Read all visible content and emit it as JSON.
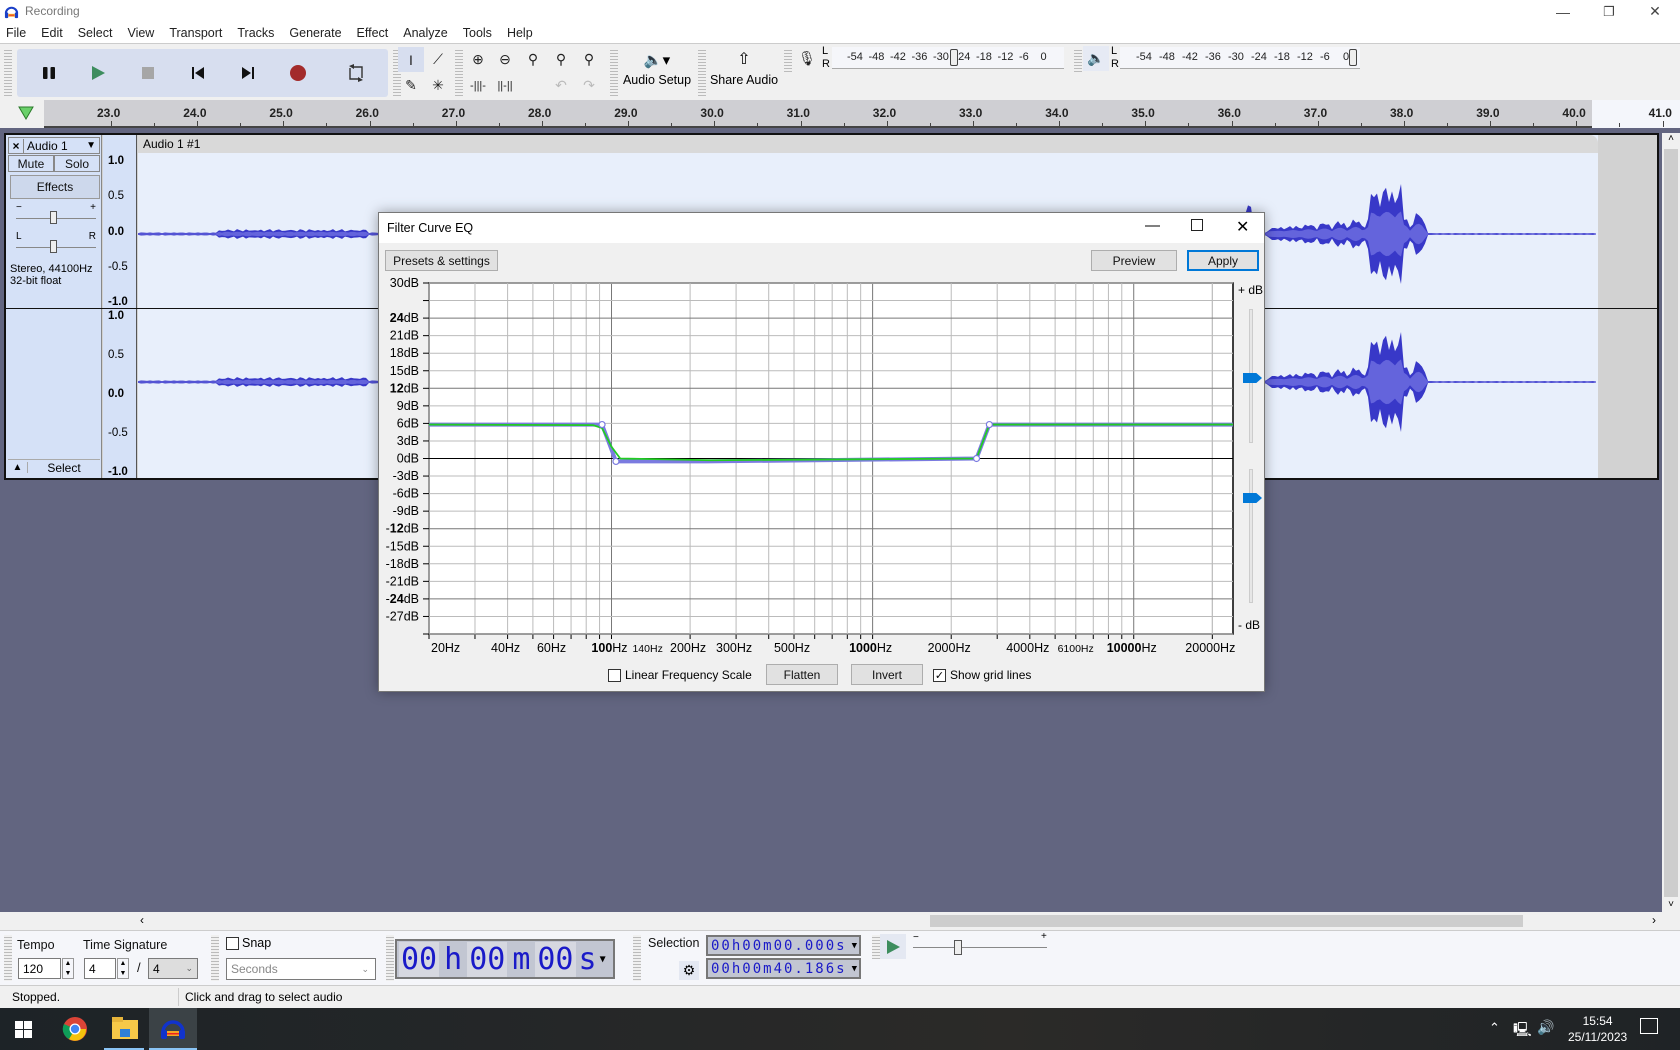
{
  "window": {
    "title": "Recording",
    "minimize": "—",
    "maximize": "❐",
    "close": "✕"
  },
  "menu": [
    "File",
    "Edit",
    "Select",
    "View",
    "Transport",
    "Tracks",
    "Generate",
    "Effect",
    "Analyze",
    "Tools",
    "Help"
  ],
  "transport": {
    "buttons": [
      "pause",
      "play",
      "stop",
      "skip-to-start",
      "skip-to-end",
      "record",
      "loop"
    ]
  },
  "tools": {
    "audio_setup": "Audio Setup",
    "share_audio": "Share Audio"
  },
  "meters": {
    "record_scale": [
      "-54",
      "-48",
      "-42",
      "-36",
      "-30",
      "-24",
      "-18",
      "-12",
      "-6",
      "0"
    ],
    "play_scale": [
      "-54",
      "-48",
      "-42",
      "-36",
      "-30",
      "-24",
      "-18",
      "-12",
      "-6",
      "0"
    ],
    "L": "L",
    "R": "R"
  },
  "ruler": {
    "ticks": [
      "23.0",
      "24.0",
      "25.0",
      "26.0",
      "27.0",
      "28.0",
      "29.0",
      "30.0",
      "31.0",
      "32.0",
      "33.0",
      "34.0",
      "35.0",
      "36.0",
      "37.0",
      "38.0",
      "39.0",
      "40.0",
      "41.0"
    ]
  },
  "track": {
    "name": "Audio 1",
    "clip_name": "Audio 1 #1",
    "mute": "Mute",
    "solo": "Solo",
    "effects": "Effects",
    "gain_minus": "−",
    "gain_plus": "+",
    "pan_L": "L",
    "pan_R": "R",
    "info_line1": "Stereo, 44100Hz",
    "info_line2": "32-bit float",
    "select": "Select",
    "scale": [
      "1.0",
      "0.5",
      "0.0",
      "-0.5",
      "-1.0"
    ]
  },
  "dialog": {
    "title": "Filter Curve EQ",
    "presets": "Presets & settings",
    "preview": "Preview",
    "apply": "Apply",
    "plus_db": "+ dB",
    "minus_db": "- dB",
    "linear_freq": "Linear Frequency Scale",
    "linear_freq_checked": false,
    "flatten": "Flatten",
    "invert": "Invert",
    "show_grid": "Show grid lines",
    "show_grid_checked": true
  },
  "chart_data": {
    "type": "line",
    "title": "Filter Curve EQ",
    "xscale": "log",
    "xlim": [
      20,
      24000
    ],
    "ylim": [
      -30,
      30
    ],
    "x_tick_labels": [
      {
        "v": 20,
        "t": "20Hz"
      },
      {
        "v": 40,
        "t": "40Hz"
      },
      {
        "v": 60,
        "t": "60Hz"
      },
      {
        "v": 100,
        "t": "100Hz",
        "bold": "100"
      },
      {
        "v": 140,
        "t": "140Hz",
        "small": true
      },
      {
        "v": 200,
        "t": "200Hz"
      },
      {
        "v": 300,
        "t": "300Hz"
      },
      {
        "v": 500,
        "t": "500Hz"
      },
      {
        "v": 1000,
        "t": "1000Hz",
        "bold": "1000"
      },
      {
        "v": 2000,
        "t": "2000Hz"
      },
      {
        "v": 4000,
        "t": "4000Hz"
      },
      {
        "v": 6100,
        "t": "6100Hz",
        "small": true
      },
      {
        "v": 10000,
        "t": "10000Hz",
        "bold": "10000"
      },
      {
        "v": 20000,
        "t": "20000Hz"
      }
    ],
    "y_tick_labels": [
      {
        "v": 30,
        "t": "30dB"
      },
      {
        "v": 24,
        "t": "24dB",
        "bold": "24"
      },
      {
        "v": 21,
        "t": "21dB"
      },
      {
        "v": 18,
        "t": "18dB"
      },
      {
        "v": 15,
        "t": "15dB"
      },
      {
        "v": 12,
        "t": "12dB",
        "bold": "12"
      },
      {
        "v": 9,
        "t": "9dB"
      },
      {
        "v": 6,
        "t": "6dB"
      },
      {
        "v": 3,
        "t": "3dB"
      },
      {
        "v": 0,
        "t": "0dB"
      },
      {
        "v": -3,
        "t": "-3dB"
      },
      {
        "v": -6,
        "t": "-6dB"
      },
      {
        "v": -9,
        "t": "-9dB"
      },
      {
        "v": -12,
        "t": "-12dB",
        "bold": "12"
      },
      {
        "v": -15,
        "t": "-15dB"
      },
      {
        "v": -18,
        "t": "-18dB"
      },
      {
        "v": -21,
        "t": "-21dB"
      },
      {
        "v": -24,
        "t": "-24dB",
        "bold": "24"
      },
      {
        "v": -27,
        "t": "-27dB"
      }
    ],
    "series": [
      {
        "name": "control-curve",
        "color": "#7b7be0",
        "points": [
          [
            20,
            5.8
          ],
          [
            92,
            5.8
          ],
          [
            104,
            -0.5
          ],
          [
            230,
            -0.5
          ],
          [
            2500,
            0
          ],
          [
            2800,
            5.8
          ],
          [
            24000,
            5.8
          ]
        ]
      },
      {
        "name": "response",
        "color": "#22cc22",
        "points": [
          [
            20,
            5.8
          ],
          [
            85,
            5.7
          ],
          [
            92,
            5.2
          ],
          [
            100,
            2
          ],
          [
            108,
            0
          ],
          [
            240,
            -0.3
          ],
          [
            2500,
            0
          ],
          [
            2800,
            5.8
          ],
          [
            24000,
            5.8
          ]
        ]
      }
    ],
    "control_points": [
      [
        92,
        5.8
      ],
      [
        104,
        -0.5
      ],
      [
        2500,
        0
      ],
      [
        2800,
        5.8
      ]
    ],
    "grid": true
  },
  "bottom": {
    "tempo_label": "Tempo",
    "tempo": "120",
    "timesig_label": "Time Signature",
    "timesig_num": "4",
    "timesig_sep": "/",
    "timesig_den": "4",
    "snap_label": "Snap",
    "snap_checked": false,
    "snap_unit": "Seconds",
    "time_display": [
      "00",
      "h",
      "00",
      "m",
      "00",
      "s"
    ],
    "selection_label": "Selection",
    "sel_start": "00h00m00.000s",
    "sel_end": "00h00m40.186s"
  },
  "status": {
    "left": "Stopped.",
    "right": "Click and drag to select audio"
  },
  "taskbar": {
    "time": "15:54",
    "date": "25/11/2023"
  }
}
